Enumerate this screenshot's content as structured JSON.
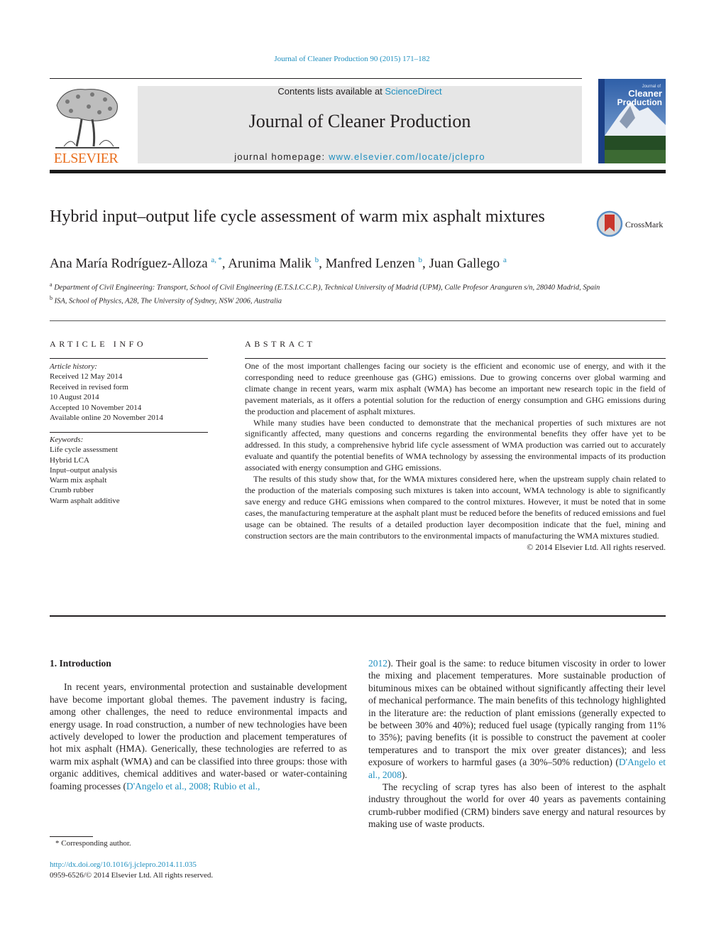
{
  "header": {
    "journal_ref": "Journal of Cleaner Production 90 (2015) 171–182",
    "contents_prefix": "Contents lists available at ",
    "contents_link": "ScienceDirect",
    "journal_title": "Journal of Cleaner Production",
    "homepage_prefix": "journal homepage: ",
    "homepage_link": "www.elsevier.com/locate/jclepro",
    "publisher": "ELSEVIER",
    "cover": {
      "small_title": "Journal of",
      "title_line1": "Cleaner",
      "title_line2": "Production"
    },
    "brand_color": "#e96f1e",
    "link_color": "#1f8fbf"
  },
  "article": {
    "title": "Hybrid input–output life cycle assessment of warm mix asphalt mixtures",
    "crossmark_label": "CrossMark",
    "authors": [
      {
        "name": "Ana María Rodríguez-Alloza",
        "sup": "a, *"
      },
      {
        "name": "Arunima Malik",
        "sup": "b"
      },
      {
        "name": "Manfred Lenzen",
        "sup": "b"
      },
      {
        "name": "Juan Gallego",
        "sup": "a"
      }
    ],
    "affiliations": [
      {
        "sup": "a",
        "text": "Department of Civil Engineering: Transport, School of Civil Engineering (E.T.S.I.C.C.P.), Technical University of Madrid (UPM), Calle Profesor Aranguren s/n, 28040 Madrid, Spain"
      },
      {
        "sup": "b",
        "text": "ISA, School of Physics, A28, The University of Sydney, NSW 2006, Australia"
      }
    ]
  },
  "article_info": {
    "heading": "ARTICLE INFO",
    "history_label": "Article history:",
    "history": [
      "Received 12 May 2014",
      "Received in revised form",
      "10 August 2014",
      "Accepted 10 November 2014",
      "Available online 20 November 2014"
    ],
    "keywords_label": "Keywords:",
    "keywords": [
      "Life cycle assessment",
      "Hybrid LCA",
      "Input–output analysis",
      "Warm mix asphalt",
      "Crumb rubber",
      "Warm asphalt additive"
    ]
  },
  "abstract": {
    "heading": "ABSTRACT",
    "paragraphs": [
      "One of the most important challenges facing our society is the efficient and economic use of energy, and with it the corresponding need to reduce greenhouse gas (GHG) emissions. Due to growing concerns over global warming and climate change in recent years, warm mix asphalt (WMA) has become an important new research topic in the field of pavement materials, as it offers a potential solution for the reduction of energy consumption and GHG emissions during the production and placement of asphalt mixtures.",
      "While many studies have been conducted to demonstrate that the mechanical properties of such mixtures are not significantly affected, many questions and concerns regarding the environmental benefits they offer have yet to be addressed. In this study, a comprehensive hybrid life cycle assessment of WMA production was carried out to accurately evaluate and quantify the potential benefits of WMA technology by assessing the environmental impacts of its production associated with energy consumption and GHG emissions.",
      "The results of this study show that, for the WMA mixtures considered here, when the upstream supply chain related to the production of the materials composing such mixtures is taken into account, WMA technology is able to significantly save energy and reduce GHG emissions when compared to the control mixtures. However, it must be noted that in some cases, the manufacturing temperature at the asphalt plant must be reduced before the benefits of reduced emissions and fuel usage can be obtained. The results of a detailed production layer decomposition indicate that the fuel, mining and construction sectors are the main contributors to the environmental impacts of manufacturing the WMA mixtures studied."
    ],
    "copyright": "© 2014 Elsevier Ltd. All rights reserved."
  },
  "body": {
    "intro_heading": "1.  Introduction",
    "p1_text": "In recent years, environmental protection and sustainable development have become important global themes. The pavement industry is facing, among other challenges, the need to reduce environmental impacts and energy usage. In road construction, a number of new technologies have been actively developed to lower the production and placement temperatures of hot mix asphalt (HMA). Generically, these technologies are referred to as warm mix asphalt (WMA) and can be classified into three groups: those with organic additives, chemical additives and water-based or water-containing foaming processes (",
    "p1_cite_left": "D'Angelo et al., 2008; Rubio et al.,",
    "p1_cite_right": "2012",
    "p1_cont": "). Their goal is the same: to reduce bitumen viscosity in order to lower the mixing and placement temperatures. More sustainable production of bituminous mixes can be obtained without significantly affecting their level of mechanical performance. The main benefits of this technology highlighted in the literature are: the reduction of plant emissions (generally expected to be between 30% and 40%); reduced fuel usage (typically ranging from 11% to 35%); paving benefits (it is possible to construct the pavement at cooler temperatures and to transport the mix over greater distances); and less exposure of workers to harmful gases (a 30%–50% reduction) (",
    "p1_cite2": "D'Angelo et al., 2008",
    "p1_end": ").",
    "p2_text": "The recycling of scrap tyres has also been of interest to the asphalt industry throughout the world for over 40 years as pavements containing crumb-rubber modified (CRM) binders save energy and natural resources by making use of waste products."
  },
  "footer": {
    "footnote": "*  Corresponding author.",
    "doi": "http://dx.doi.org/10.1016/j.jclepro.2014.11.035",
    "issn": "0959-6526/© 2014 Elsevier Ltd. All rights reserved."
  }
}
